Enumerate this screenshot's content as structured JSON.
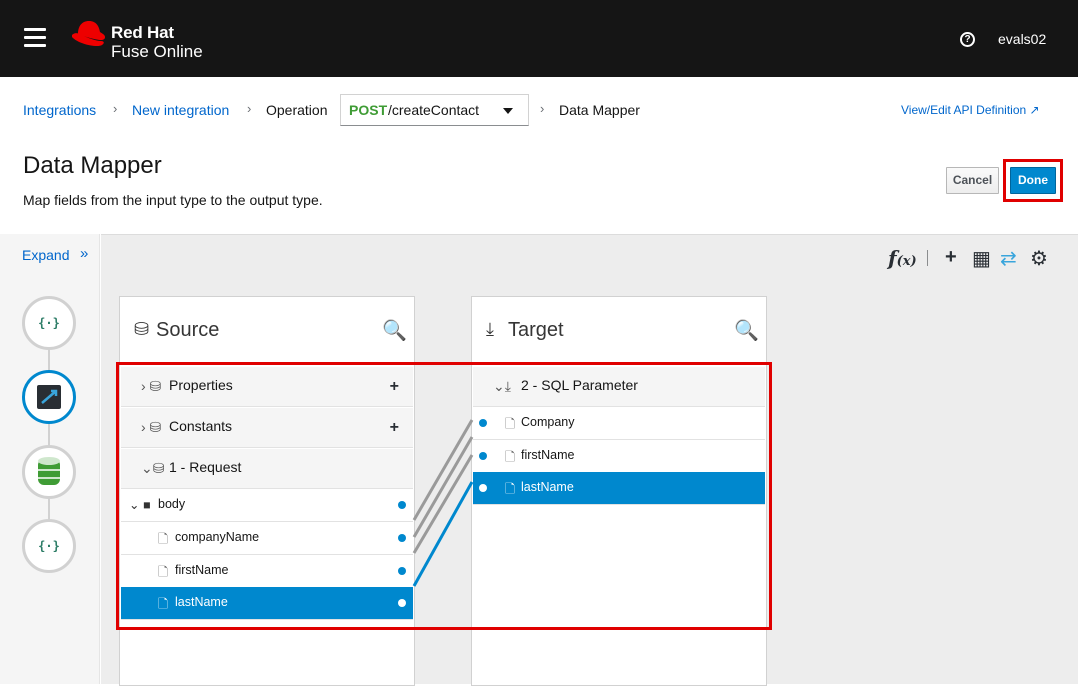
{
  "header": {
    "brand_line1": "Red Hat",
    "brand_line2": "Fuse Online",
    "help_icon": "?",
    "username": "evals02"
  },
  "breadcrumb": {
    "integrations": "Integrations",
    "new_integration": "New integration",
    "operation_label": "Operation",
    "operation_method": "POST",
    "operation_path": "/createContact",
    "current": "Data Mapper",
    "separator": "›",
    "api_link": "View/Edit API Definition ↗"
  },
  "page": {
    "title": "Data Mapper",
    "subtitle": "Map fields from the input type to the output type.",
    "cancel_label": "Cancel",
    "done_label": "Done"
  },
  "rail": {
    "expand_label": "Expand",
    "expand_chevron": "»",
    "steps": [
      {
        "icon": "api-icon",
        "glyph": "{·}"
      },
      {
        "icon": "data-mapper-icon",
        "glyph": "⇄"
      },
      {
        "icon": "database-icon",
        "glyph": ""
      },
      {
        "icon": "api-icon",
        "glyph": "{·}"
      }
    ]
  },
  "toolbar": {
    "fx_label": "f",
    "fx_sub": "(x)",
    "add_icon": "+",
    "table_icon": "▦",
    "swap_icon": "⇄",
    "settings_icon": "⚙"
  },
  "source": {
    "title": "Source",
    "title_icon": "⛁",
    "search_icon": "🔍",
    "items": [
      {
        "label": "Properties",
        "prefix": "› ⛁",
        "type": "head",
        "plus": "+"
      },
      {
        "label": "Constants",
        "prefix": "› ⛁",
        "type": "head",
        "plus": "+"
      },
      {
        "label": "1 - Request",
        "prefix": "⌄⛁",
        "type": "head"
      },
      {
        "label": "body",
        "prefix": "⌄ ■",
        "type": "folder"
      },
      {
        "label": "companyName",
        "prefix": "🗋",
        "type": "field"
      },
      {
        "label": "firstName",
        "prefix": "🗋",
        "type": "field"
      },
      {
        "label": "lastName",
        "prefix": "🗋",
        "type": "field",
        "selected": true
      }
    ]
  },
  "target": {
    "title": "Target",
    "title_icon": "⤓",
    "search_icon": "🔍",
    "items": [
      {
        "label": "2 - SQL Parameter",
        "prefix": "⌄⤓",
        "type": "head"
      },
      {
        "label": "Company",
        "prefix": "🗋",
        "type": "field"
      },
      {
        "label": "firstName",
        "prefix": "🗋",
        "type": "field"
      },
      {
        "label": "lastName",
        "prefix": "🗋",
        "type": "field",
        "selected": true
      }
    ]
  },
  "colors": {
    "brand_red": "#ee0000",
    "link": "#0066cc",
    "selected": "#0088ce",
    "method_green": "#3f9c35",
    "mapping_line": "#9a9a9a",
    "active_line": "#0088ce",
    "highlight": "#e00000"
  }
}
